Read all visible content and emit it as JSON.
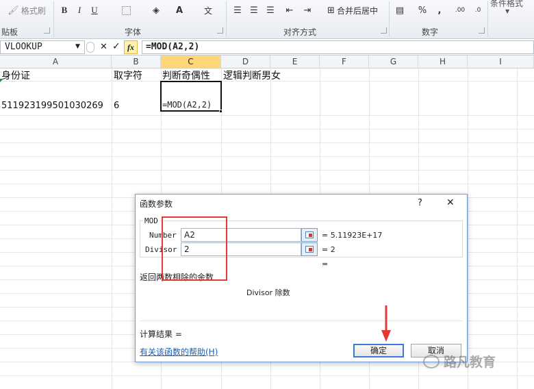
{
  "ribbon": {
    "format_painter": "格式刷",
    "clipboard_label": "贴板",
    "font_label": "字体",
    "align_label": "对齐方式",
    "number_label": "数字",
    "merge_center": "合并后居中",
    "conditional_format": "条件格式",
    "bold": "B",
    "italic": "I",
    "underline": "U",
    "percent": "%",
    "comma": ","
  },
  "formula_bar": {
    "name_box": "VLOOKUP",
    "cancel": "✕",
    "enter": "✓",
    "fx": "fx",
    "formula": "=MOD(A2,2)"
  },
  "columns": [
    "A",
    "B",
    "C",
    "D",
    "E",
    "F",
    "G",
    "H",
    "I"
  ],
  "cells": {
    "a1": "身份证",
    "b1": "取字符",
    "c1": "判断奇偶性",
    "d1": "逻辑判断男女",
    "a2": "511923199501030269",
    "b2": "6",
    "c2": "=MOD(A2,2)"
  },
  "dialog": {
    "title": "函数参数",
    "help_glyph": "?",
    "close_glyph": "✕",
    "function_name": "MOD",
    "args": [
      {
        "label": "Number",
        "value": "A2",
        "result": "= 5.11923E+17"
      },
      {
        "label": "Divisor",
        "value": "2",
        "result": "= 2"
      }
    ],
    "total_eq": "=",
    "description": "返回两数相除的余数",
    "arg_help": "Divisor  除数",
    "calc_result": "计算结果 =",
    "help_link": "有关该函数的帮助(H)",
    "ok": "确定",
    "cancel": "取消"
  },
  "watermark": "路凡教育",
  "colors": {
    "selected_column_header": "#ffd77a",
    "annotation_red": "#e53935",
    "dialog_border": "#6f9ad6",
    "link": "#1a5fb4"
  }
}
